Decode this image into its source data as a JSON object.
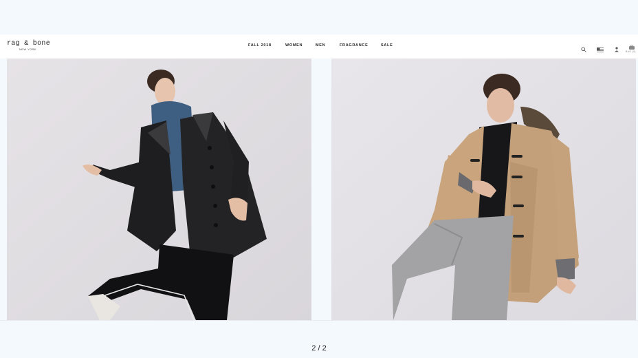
{
  "brand": {
    "name": "rag & bone",
    "location": "NEW YORK"
  },
  "nav": {
    "items": [
      "FALL 2018",
      "WOMEN",
      "MEN",
      "FRAGRANCE",
      "SALE"
    ]
  },
  "utility": {
    "icons": [
      "search-icon",
      "us-flag-icon",
      "account-icon",
      "bag-icon"
    ],
    "bag_label": "BAG (0)"
  },
  "gallery": {
    "images": [
      {
        "name": "women-leather-coat-look",
        "alt": "Model in black leather coat, blue hoodie and black track pants"
      },
      {
        "name": "men-camel-duffle-coat-look",
        "alt": "Model in camel duffle coat and grey sweatpants"
      }
    ]
  },
  "pager": {
    "text": "2 / 2"
  },
  "colors": {
    "background": "#f4f9fd",
    "header": "#ffffff",
    "photo_bg": "#e3dfe3"
  }
}
